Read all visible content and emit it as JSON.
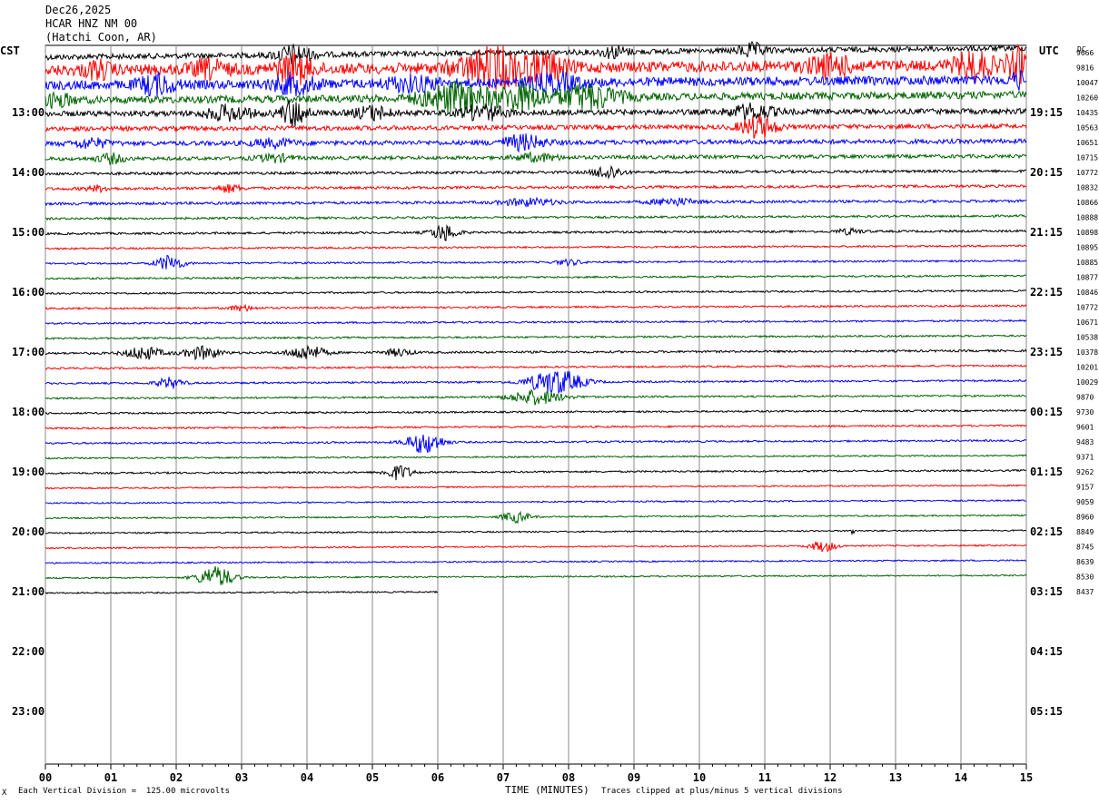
{
  "header": {
    "date": "Dec26,2025",
    "station": "HCAR HNZ NM 00",
    "location": "(Hatchi Coon, AR)"
  },
  "left_zone_label": "CST",
  "right_zone_label": "UTC",
  "dc_label": "DC",
  "footer": {
    "scale_note": "Each Vertical Division =  125.00 microvolts",
    "clip_note": "Traces clipped at plus/minus 5 vertical divisions",
    "corner_mark": "X"
  },
  "chart_data": {
    "type": "line",
    "title": "",
    "xlabel": "TIME (MINUTES)",
    "ylabel": "",
    "x_ticks": [
      "00",
      "01",
      "02",
      "03",
      "04",
      "05",
      "06",
      "07",
      "08",
      "09",
      "10",
      "11",
      "12",
      "13",
      "14",
      "15"
    ],
    "xlim": [
      0,
      15
    ],
    "trace_interval_minutes": 15,
    "trace_colors": [
      "#000000",
      "#ff0000",
      "#0000ff",
      "#006400"
    ],
    "cst_hour_labels": [
      {
        "trace_index": 4,
        "label": "13:00"
      },
      {
        "trace_index": 8,
        "label": "14:00"
      },
      {
        "trace_index": 12,
        "label": "15:00"
      },
      {
        "trace_index": 16,
        "label": "16:00"
      },
      {
        "trace_index": 20,
        "label": "17:00"
      },
      {
        "trace_index": 24,
        "label": "18:00"
      },
      {
        "trace_index": 28,
        "label": "19:00"
      },
      {
        "trace_index": 32,
        "label": "20:00"
      },
      {
        "trace_index": 36,
        "label": "21:00"
      },
      {
        "trace_index": 40,
        "label": "22:00"
      },
      {
        "trace_index": 44,
        "label": "23:00"
      }
    ],
    "utc_labels": [
      {
        "trace_index": 4,
        "label": "19:15"
      },
      {
        "trace_index": 8,
        "label": "20:15"
      },
      {
        "trace_index": 12,
        "label": "21:15"
      },
      {
        "trace_index": 16,
        "label": "22:15"
      },
      {
        "trace_index": 20,
        "label": "23:15"
      },
      {
        "trace_index": 24,
        "label": "00:15"
      },
      {
        "trace_index": 28,
        "label": "01:15"
      },
      {
        "trace_index": 32,
        "label": "02:15"
      },
      {
        "trace_index": 36,
        "label": "03:15"
      },
      {
        "trace_index": 40,
        "label": "04:15"
      },
      {
        "trace_index": 44,
        "label": "05:15"
      }
    ],
    "dc_offsets": [
      "9666",
      "9816",
      "10047",
      "10260",
      "10435",
      "10563",
      "10651",
      "10715",
      "10772",
      "10832",
      "10866",
      "10888",
      "10898",
      "10895",
      "10885",
      "10877",
      "10846",
      "10772",
      "10671",
      "10538",
      "10378",
      "10201",
      "10029",
      "9870",
      "9730",
      "9601",
      "9483",
      "9371",
      "9262",
      "9157",
      "9059",
      "8960",
      "8849",
      "8745",
      "8639",
      "8530",
      "8437"
    ],
    "traces": [
      {
        "noise": 3,
        "events": [
          {
            "t": 3.8,
            "amp": 10,
            "dur": 0.4
          },
          {
            "t": 8.7,
            "amp": 6,
            "dur": 0.3
          },
          {
            "t": 10.8,
            "amp": 7,
            "dur": 0.3
          }
        ]
      },
      {
        "noise": 6,
        "events": [
          {
            "t": 0.8,
            "amp": 8,
            "dur": 0.3
          },
          {
            "t": 2.5,
            "amp": 8,
            "dur": 0.4
          },
          {
            "t": 3.8,
            "amp": 14,
            "dur": 0.4
          },
          {
            "t": 6.9,
            "amp": 20,
            "dur": 0.8
          },
          {
            "t": 7.7,
            "amp": 12,
            "dur": 0.4
          },
          {
            "t": 12.0,
            "amp": 10,
            "dur": 0.5
          },
          {
            "t": 14.2,
            "amp": 14,
            "dur": 0.4
          },
          {
            "t": 14.9,
            "amp": 16,
            "dur": 0.3
          }
        ]
      },
      {
        "noise": 5,
        "events": [
          {
            "t": 1.7,
            "amp": 10,
            "dur": 0.4
          },
          {
            "t": 3.8,
            "amp": 9,
            "dur": 0.5
          },
          {
            "t": 5.6,
            "amp": 7,
            "dur": 0.6
          },
          {
            "t": 7.8,
            "amp": 8,
            "dur": 0.6
          },
          {
            "t": 14.9,
            "amp": 8,
            "dur": 0.2
          }
        ]
      },
      {
        "noise": 4,
        "events": [
          {
            "t": 0.2,
            "amp": 7,
            "dur": 0.3
          },
          {
            "t": 6.3,
            "amp": 16,
            "dur": 0.8
          },
          {
            "t": 7.3,
            "amp": 14,
            "dur": 0.5
          },
          {
            "t": 8.3,
            "amp": 13,
            "dur": 0.7
          }
        ]
      },
      {
        "noise": 3,
        "events": [
          {
            "t": 2.8,
            "amp": 8,
            "dur": 0.5
          },
          {
            "t": 3.8,
            "amp": 14,
            "dur": 0.3
          },
          {
            "t": 5.0,
            "amp": 7,
            "dur": 0.4
          },
          {
            "t": 6.7,
            "amp": 8,
            "dur": 0.5
          },
          {
            "t": 10.8,
            "amp": 8,
            "dur": 0.5
          }
        ]
      },
      {
        "noise": 2.5,
        "events": [
          {
            "t": 10.9,
            "amp": 12,
            "dur": 0.4
          }
        ]
      },
      {
        "noise": 2.5,
        "events": [
          {
            "t": 0.7,
            "amp": 5,
            "dur": 0.4
          },
          {
            "t": 3.5,
            "amp": 4,
            "dur": 0.5
          },
          {
            "t": 7.3,
            "amp": 8,
            "dur": 0.5
          }
        ]
      },
      {
        "noise": 2,
        "events": [
          {
            "t": 1.0,
            "amp": 5,
            "dur": 0.3
          },
          {
            "t": 3.5,
            "amp": 4,
            "dur": 0.4
          },
          {
            "t": 7.5,
            "amp": 4,
            "dur": 0.5
          }
        ]
      },
      {
        "noise": 1.5,
        "events": [
          {
            "t": 8.6,
            "amp": 8,
            "dur": 0.3
          }
        ]
      },
      {
        "noise": 1.5,
        "events": [
          {
            "t": 0.8,
            "amp": 3,
            "dur": 0.3
          },
          {
            "t": 2.8,
            "amp": 4,
            "dur": 0.3
          }
        ]
      },
      {
        "noise": 1.5,
        "events": [
          {
            "t": 7.4,
            "amp": 4,
            "dur": 0.6
          },
          {
            "t": 9.6,
            "amp": 4,
            "dur": 0.5
          }
        ]
      },
      {
        "noise": 1.2,
        "events": []
      },
      {
        "noise": 1.2,
        "events": [
          {
            "t": 6.1,
            "amp": 9,
            "dur": 0.3
          },
          {
            "t": 12.3,
            "amp": 3,
            "dur": 0.3
          }
        ]
      },
      {
        "noise": 1,
        "events": []
      },
      {
        "noise": 1,
        "events": [
          {
            "t": 1.9,
            "amp": 9,
            "dur": 0.3
          },
          {
            "t": 8.0,
            "amp": 3,
            "dur": 0.3
          }
        ]
      },
      {
        "noise": 1,
        "events": []
      },
      {
        "noise": 1,
        "events": []
      },
      {
        "noise": 1,
        "events": [
          {
            "t": 3.0,
            "amp": 3,
            "dur": 0.3
          }
        ]
      },
      {
        "noise": 1,
        "events": []
      },
      {
        "noise": 1,
        "events": []
      },
      {
        "noise": 1.2,
        "events": [
          {
            "t": 1.5,
            "amp": 7,
            "dur": 0.4
          },
          {
            "t": 2.4,
            "amp": 7,
            "dur": 0.4
          },
          {
            "t": 4.0,
            "amp": 8,
            "dur": 0.4
          },
          {
            "t": 5.4,
            "amp": 4,
            "dur": 0.3
          }
        ]
      },
      {
        "noise": 1,
        "events": []
      },
      {
        "noise": 1,
        "events": [
          {
            "t": 1.9,
            "amp": 6,
            "dur": 0.3
          },
          {
            "t": 7.8,
            "amp": 14,
            "dur": 0.6
          }
        ]
      },
      {
        "noise": 1,
        "events": [
          {
            "t": 7.5,
            "amp": 8,
            "dur": 0.6
          }
        ]
      },
      {
        "noise": 1,
        "events": []
      },
      {
        "noise": 1,
        "events": []
      },
      {
        "noise": 1,
        "events": [
          {
            "t": 5.8,
            "amp": 12,
            "dur": 0.4
          }
        ]
      },
      {
        "noise": 0.8,
        "events": []
      },
      {
        "noise": 1,
        "events": [
          {
            "t": 5.4,
            "amp": 8,
            "dur": 0.3
          }
        ]
      },
      {
        "noise": 0.8,
        "events": []
      },
      {
        "noise": 0.8,
        "events": []
      },
      {
        "noise": 0.8,
        "events": [
          {
            "t": 7.2,
            "amp": 6,
            "dur": 0.3
          }
        ]
      },
      {
        "noise": 0.8,
        "events": [
          {
            "t": 12.35,
            "amp": 4,
            "dur": 0.05
          }
        ]
      },
      {
        "noise": 0.8,
        "events": [
          {
            "t": 11.9,
            "amp": 6,
            "dur": 0.3
          }
        ]
      },
      {
        "noise": 0.8,
        "events": []
      },
      {
        "noise": 0.8,
        "events": [
          {
            "t": 2.6,
            "amp": 12,
            "dur": 0.4
          }
        ]
      },
      {
        "noise": 0.8,
        "events": [],
        "end_minute": 6.0
      }
    ]
  }
}
